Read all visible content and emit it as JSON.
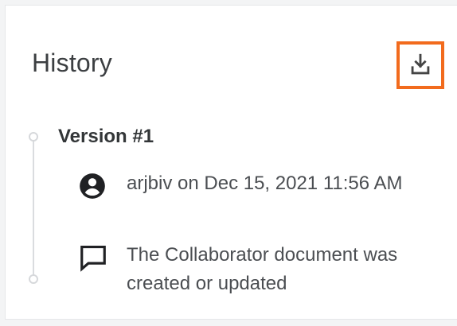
{
  "history": {
    "title": "History",
    "download_icon": "download-icon"
  },
  "versions": [
    {
      "title": "Version #1",
      "user_icon": "account-circle-icon",
      "author_line": "arjbiv on Dec 15, 2021 11:56 AM",
      "comment_icon": "comment-icon",
      "description": "The Collaborator document was created or updated"
    }
  ],
  "colors": {
    "highlight": "#f26b1d",
    "timeline": "#d6d8db",
    "text": "#4b4e52"
  }
}
